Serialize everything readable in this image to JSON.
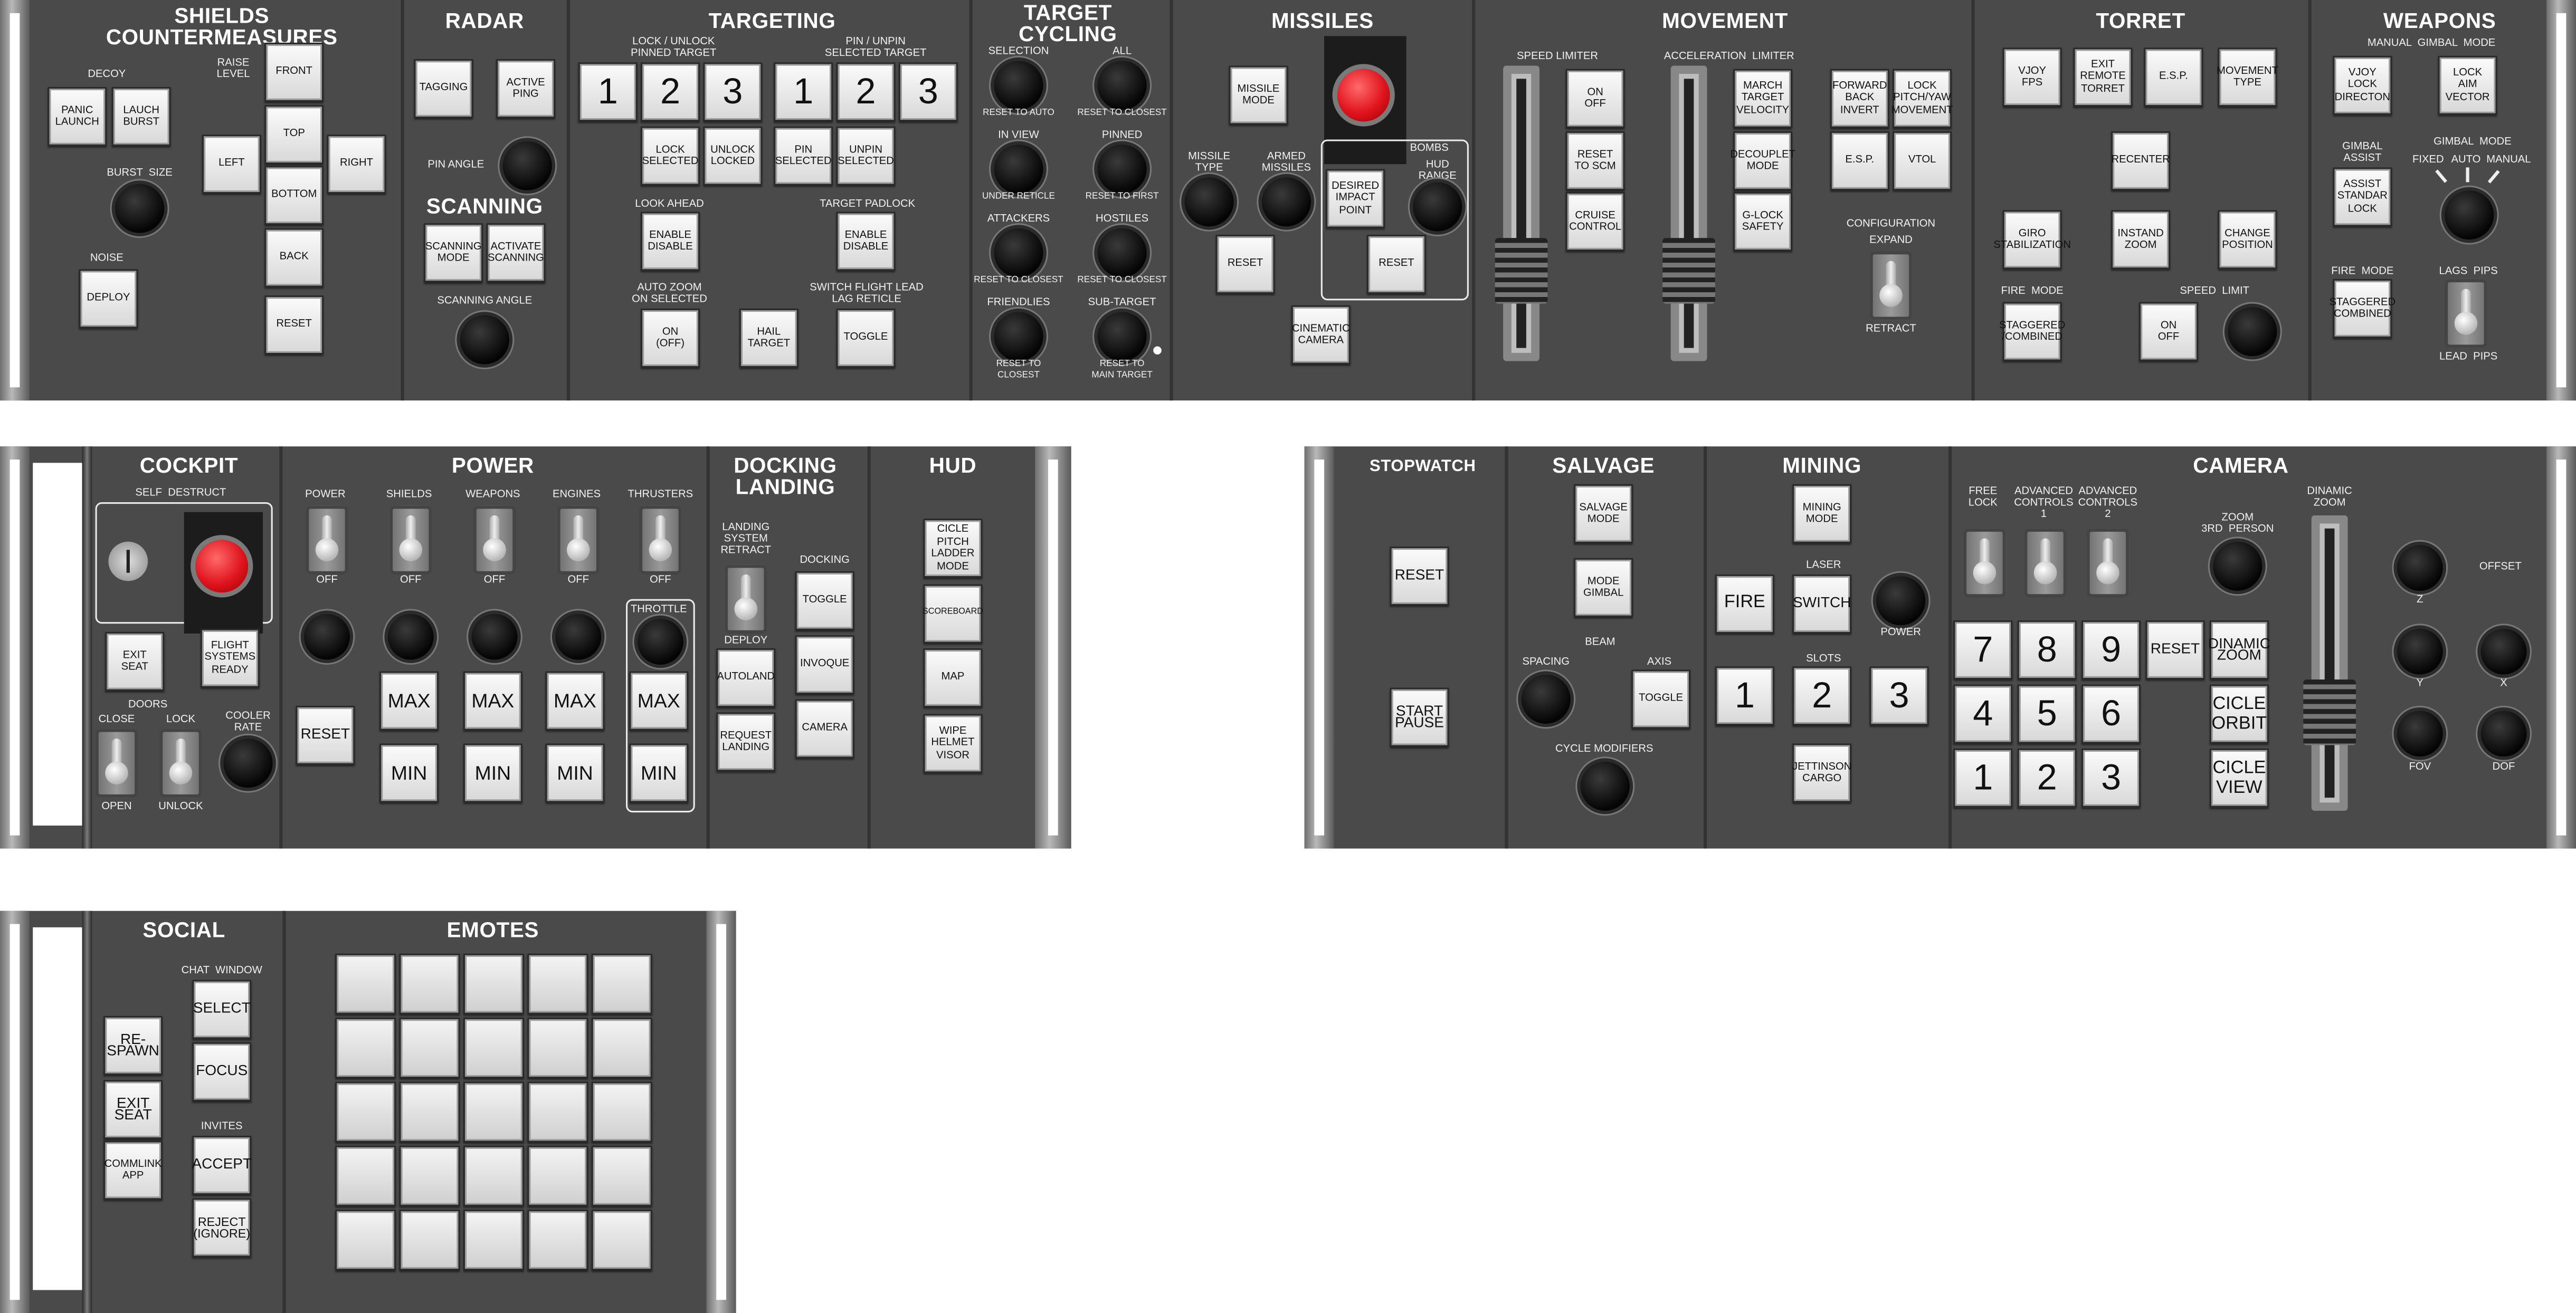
{
  "top_panel": {
    "shields": {
      "title": "SHIELDS\nCOUNTERMEASURES",
      "decoy_label": "DECOY",
      "panic_launch": "PANIC\nLAUNCH",
      "launch_burst": "LAUCH\nBURST",
      "raise_level": "RAISE\nLEVEL",
      "front": "FRONT",
      "left": "LEFT",
      "top": "TOP",
      "right": "RIGHT",
      "bottom": "BOTTOM",
      "back": "BACK",
      "reset": "RESET",
      "burst_size": "BURST  SIZE",
      "noise": "NOISE",
      "deploy": "DEPLOY"
    },
    "radar": {
      "title": "RADAR",
      "tagging": "TAGGING",
      "active_ping": "ACTIVE\nPING",
      "pin_angle": "PIN ANGLE",
      "scanning_title": "SCANNING",
      "scanning_mode": "SCANNING\nMODE",
      "activate_scanning": "ACTIVATE\nSCANNING",
      "scanning_angle": "SCANNING ANGLE"
    },
    "targeting": {
      "title": "TARGETING",
      "lock_unlock": "LOCK / UNLOCK\nPINNED TARGET",
      "pin_unpin": "PIN / UNPIN\nSELECTED TARGET",
      "lock_nums": [
        "1",
        "2",
        "3"
      ],
      "pin_nums": [
        "1",
        "2",
        "3"
      ],
      "lock_selected": "LOCK\nSELECTED",
      "unlock_locked": "UNLOCK\nLOCKED",
      "pin_selected": "PIN\nSELECTED",
      "unpin_selected": "UNPIN\nSELECTED",
      "look_ahead": "LOOK AHEAD",
      "look_ahead_btn": "ENABLE\nDISABLE",
      "target_padlock": "TARGET PADLOCK",
      "padlock_btn": "ENABLE\nDISABLE",
      "auto_zoom": "AUTO ZOOM\nON SELECTED",
      "auto_zoom_btn": "ON\n(OFF)",
      "hail_target": "HAIL\nTARGET",
      "switch_flight": "SWITCH FLIGHT LEAD\nLAG RETICLE",
      "toggle": "TOGGLE"
    },
    "cycling": {
      "title": "TARGET\nCYCLING",
      "selection": "SELECTION",
      "reset_auto": "RESET TO AUTO",
      "all": "ALL",
      "reset_closest": "RESET TO CLOSEST",
      "in_view": "IN VIEW",
      "under_reticle": "UNDER RETICLE",
      "pinned": "PINNED",
      "reset_first": "RESET TO FIRST",
      "attackers": "ATTACKERS",
      "attackers_sub": "RESET TO CLOSEST",
      "hostiles": "HOSTILES",
      "hostiles_sub": "RESET TO CLOSEST",
      "friendlies": "FRIENDLIES",
      "friendlies_sub": "RESET TO\nCLOSEST",
      "sub_target": "SUB-TARGET",
      "sub_target_sub": "RESET TO\nMAIN TARGET"
    },
    "missiles": {
      "title": "MISSILES",
      "missile_mode": "MISSILE\nMODE",
      "missile_type": "MISSILE\nTYPE",
      "armed_missiles": "ARMED\nMISSILES",
      "reset": "RESET",
      "bombs": "BOMBS",
      "hud_range": "HUD\nRANGE",
      "desired_impact": "DESIRED\nIMPACT\nPOINT",
      "bombs_reset": "RESET",
      "cinematic_camera": "CINEMATIC\nCAMERA"
    },
    "movement": {
      "title": "MOVEMENT",
      "speed_limiter": "SPEED LIMITER",
      "on_off": "ON\nOFF",
      "reset_scm": "RESET\nTO SCM",
      "cruise_control": "CRUISE\nCONTROL",
      "accel_limiter": "ACCELERATION  LIMITER",
      "match_target_velocity": "MARCH\nTARGET\nVELOCITY",
      "decouplet_mode": "DECOUPLET\nMODE",
      "glock_safety": "G-LOCK\nSAFETY",
      "forward_back_invert": "FORWARD\nBACK\nINVERT",
      "lock_pitch_yaw": "LOCK\nPITCH/YAW\nMOVEMENT",
      "esp": "E.S.P.",
      "vtol": "VTOL",
      "configuration": "CONFIGURATION",
      "expand": "EXPAND",
      "retract": "RETRACT"
    },
    "torret": {
      "title": "TORRET",
      "vjoy_fps": "VJOY\nFPS",
      "exit_remote": "EXIT\nREMOTE\nTORRET",
      "esp": "E.S.P.",
      "movement_type": "MOVEMENT\nTYPE",
      "recenter": "RECENTER",
      "giro_stab": "GIRO\nSTABILIZATION",
      "instand_zoom": "INSTAND\nZOOM",
      "change_position": "CHANGE\nPOSITION",
      "fire_mode": "FIRE  MODE",
      "staggered": "STAGGERED\n/COMBINED",
      "speed_limit": "SPEED  LIMIT",
      "on_off": "ON\nOFF"
    },
    "weapons": {
      "title": "WEAPONS",
      "manual_gimbal": "MANUAL  GIMBAL  MODE",
      "vjoy_lock": "VJOY\nLOCK\nDIRECTON",
      "lock_aim": "LOCK\nAIM\nVECTOR",
      "gimbal_assist": "GIMBAL\nASSIST",
      "gimbal_mode": "GIMBAL  MODE",
      "fixed": "FIXED",
      "auto": "AUTO",
      "manual": "MANUAL",
      "assist_btn": "ASSIST\nSTANDAR\nLOCK",
      "fire_mode": "FIRE  MODE",
      "staggered": "STAGGERED\nCOMBINED",
      "lags_pips": "LAGS  PIPS",
      "lead_pips": "LEAD  PIPS"
    }
  },
  "middle_left_panel": {
    "cockpit": {
      "title": "COCKPIT",
      "self_destruct": "SELF  DESTRUCT",
      "exit_seat": "EXIT\nSEAT",
      "flight_ready": "FLIGHT\nSYSTEMS\nREADY",
      "doors": "DOORS",
      "close": "CLOSE",
      "lock": "LOCK",
      "open": "OPEN",
      "unlock": "UNLOCK",
      "cooler_rate": "COOLER\nRATE"
    },
    "power": {
      "title": "POWER",
      "channels": [
        "POWER",
        "SHIELDS",
        "WEAPONS",
        "ENGINES",
        "THRUSTERS"
      ],
      "off": "OFF",
      "throttle": "THROTTLE",
      "reset": "RESET",
      "max": "MAX",
      "min": "MIN"
    },
    "docking": {
      "title": "DOCKING\nLANDING",
      "landing_system": "LANDING\nSYSTEM\nRETRACT",
      "deploy": "DEPLOY",
      "autoland": "AUTOLAND",
      "request_landing": "REQUEST\nLANDING",
      "docking_label": "DOCKING",
      "toggle": "TOGGLE",
      "invoque": "INVOQUE",
      "camera": "CAMERA"
    },
    "hud": {
      "title": "HUD",
      "cicle_pitch": "CICLE\nPITCH\nLADDER\nMODE",
      "scoreboard": "SCOREBOARD",
      "map": "MAP",
      "wipe_visor": "WIPE\nHELMET\nVISOR"
    }
  },
  "middle_right_panel": {
    "stopwatch": {
      "title": "STOPWATCH",
      "reset": "RESET",
      "start_pause": "START\nPAUSE"
    },
    "salvage": {
      "title": "SALVAGE",
      "salvage_mode": "SALVAGE\nMODE",
      "mode_gimbal": "MODE\nGIMBAL",
      "beam": "BEAM",
      "spacing": "SPACING",
      "axis": "AXIS",
      "toggle": "TOGGLE",
      "cycle_modifiers": "CYCLE MODIFIERS"
    },
    "mining": {
      "title": "MINING",
      "mining_mode": "MINING\nMODE",
      "laser": "LASER",
      "fire": "FIRE",
      "switch": "SWITCH",
      "power": "POWER",
      "slots": "SLOTS",
      "slot_nums": [
        "1",
        "2",
        "3"
      ],
      "jettison": "JETTINSON\nCARGO"
    },
    "camera": {
      "title": "CAMERA",
      "free_lock": "FREE\nLOCK",
      "adv1": "ADVANCED\nCONTROLS\n1",
      "adv2": "ADVANCED\nCONTROLS\n2",
      "zoom_3rd": "ZOOM\n3RD  PERSON",
      "dinamic_zoom_label": "DINAMIC\nZOOM",
      "keypad": [
        "7",
        "8",
        "9",
        "4",
        "5",
        "6",
        "1",
        "2",
        "3"
      ],
      "reset": "RESET",
      "dinamic_zoom": "DINAMIC\nZOOM",
      "cicle_orbit": "CICLE\nORBIT",
      "cicle_view": "CICLE\nVIEW",
      "offset": "OFFSET",
      "z": "Z",
      "y": "Y",
      "x": "X",
      "fov": "FOV",
      "dof": "DOF"
    }
  },
  "bottom_panel": {
    "social": {
      "title": "SOCIAL",
      "chat_window": "CHAT  WINDOW",
      "respawn": "RE-\nSPAWN",
      "select": "SELECT",
      "focus": "FOCUS",
      "exit_seat": "EXIT\nSEAT",
      "invites": "INVITES",
      "commlink": "COMMLINK\nAPP",
      "accept": "ACCEPT",
      "reject": "REJECT\n(IGNORE)"
    },
    "emotes": {
      "title": "EMOTES",
      "rows": 5,
      "cols": 5
    }
  },
  "colors": {
    "panel": "#4a4a4a",
    "button": "#eeeeee",
    "label": "#ffffff",
    "red_button": "#e0141e"
  }
}
